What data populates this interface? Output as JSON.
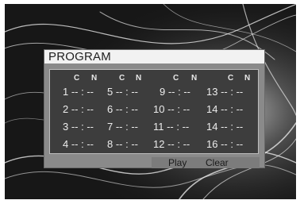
{
  "title": "PROGRAM",
  "column_headers": [
    {
      "c": "C",
      "n": "N"
    },
    {
      "c": "C",
      "n": "N"
    },
    {
      "c": "C",
      "n": "N"
    },
    {
      "c": "C",
      "n": "N"
    }
  ],
  "rows": [
    [
      "1 -- : --",
      "5 -- : --",
      "9 -- : --",
      "13 -- : --"
    ],
    [
      "2 -- : --",
      "6 -- : --",
      "10 -- : --",
      "14 -- : --"
    ],
    [
      "3 -- : --",
      "7 -- : --",
      "11 -- : --",
      "14 -- : --"
    ],
    [
      "4 -- : --",
      "8 -- : --",
      "12 -- : --",
      "16 -- : --"
    ]
  ],
  "buttons": {
    "play_label": "Play",
    "clear_label": "Clear"
  },
  "colors": {
    "panel_bg": "#8a8a8a",
    "grid_bg": "#3d3d3d",
    "title_bar_bg": "#f2f2f2",
    "screen_bg": "#1c1c1c"
  }
}
